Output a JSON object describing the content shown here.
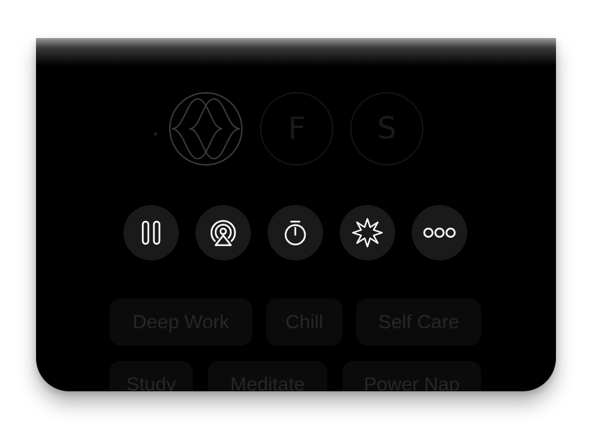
{
  "modes": [
    {
      "id": "focus-wave",
      "letter": "",
      "icon": "wave-icon",
      "active": true
    },
    {
      "id": "mode-f",
      "letter": "F",
      "active": false
    },
    {
      "id": "mode-s",
      "letter": "S",
      "active": false
    }
  ],
  "controls": [
    {
      "name": "pause-button",
      "icon": "pause-icon"
    },
    {
      "name": "cast-button",
      "icon": "airplay-icon"
    },
    {
      "name": "timer-button",
      "icon": "timer-icon"
    },
    {
      "name": "effects-button",
      "icon": "sparkle-icon"
    },
    {
      "name": "more-button",
      "icon": "more-icon"
    }
  ],
  "chips_row1": [
    "Deep Work",
    "Chill",
    "Self Care"
  ],
  "chips_row2": [
    "Study",
    "Meditate",
    "Power Nap"
  ],
  "colors": {
    "background": "#000000",
    "control_bg": "#1a1a1a",
    "icon": "#ffffff",
    "chip_bg": "#0b0b0b",
    "chip_text": "#272727"
  }
}
